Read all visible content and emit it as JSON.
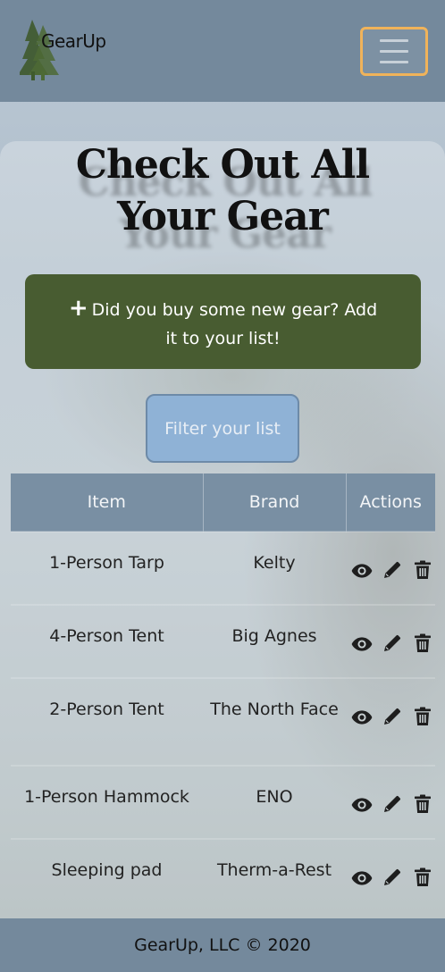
{
  "navbar": {
    "brand": "GearUp",
    "logo_icon": "pine-tree-icon",
    "toggler_icon": "hamburger-menu-icon"
  },
  "page": {
    "title": "Check Out All Your Gear"
  },
  "add_banner": {
    "icon": "plus-icon",
    "text": "Did you buy some new gear? Add it to your list!"
  },
  "filter_button": {
    "label": "Filter your list"
  },
  "table": {
    "headers": [
      "Item",
      "Brand",
      "Actions"
    ],
    "rows": [
      {
        "item": "1-Person Tarp",
        "brand": "Kelty"
      },
      {
        "item": "4-Person Tent",
        "brand": "Big Agnes"
      },
      {
        "item": "2-Person Tent",
        "brand": "The North Face"
      },
      {
        "item": "1-Person Hammock",
        "brand": "ENO"
      },
      {
        "item": "Sleeping pad",
        "brand": "Therm-a-Rest"
      }
    ],
    "action_icons": [
      "eye-icon",
      "pencil-icon",
      "trash-icon"
    ]
  },
  "footer": {
    "text": "GearUp, LLC © 2020"
  },
  "colors": {
    "navbar": "#74899c",
    "banner": "#485c31",
    "filter_button": "#8fb2d6",
    "toggler_border": "#f0b35a"
  }
}
